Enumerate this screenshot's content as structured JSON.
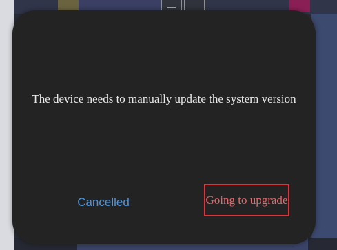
{
  "dialog": {
    "message": "The device needs to manually update the system version",
    "cancel_label": "Cancelled",
    "upgrade_label": "Going to upgrade"
  },
  "colors": {
    "dialog_background": "#232323",
    "message_text": "#e8e8e8",
    "cancel_text": "#4f93d8",
    "upgrade_text": "#e36a6d",
    "highlight_border": "#e0343a"
  }
}
